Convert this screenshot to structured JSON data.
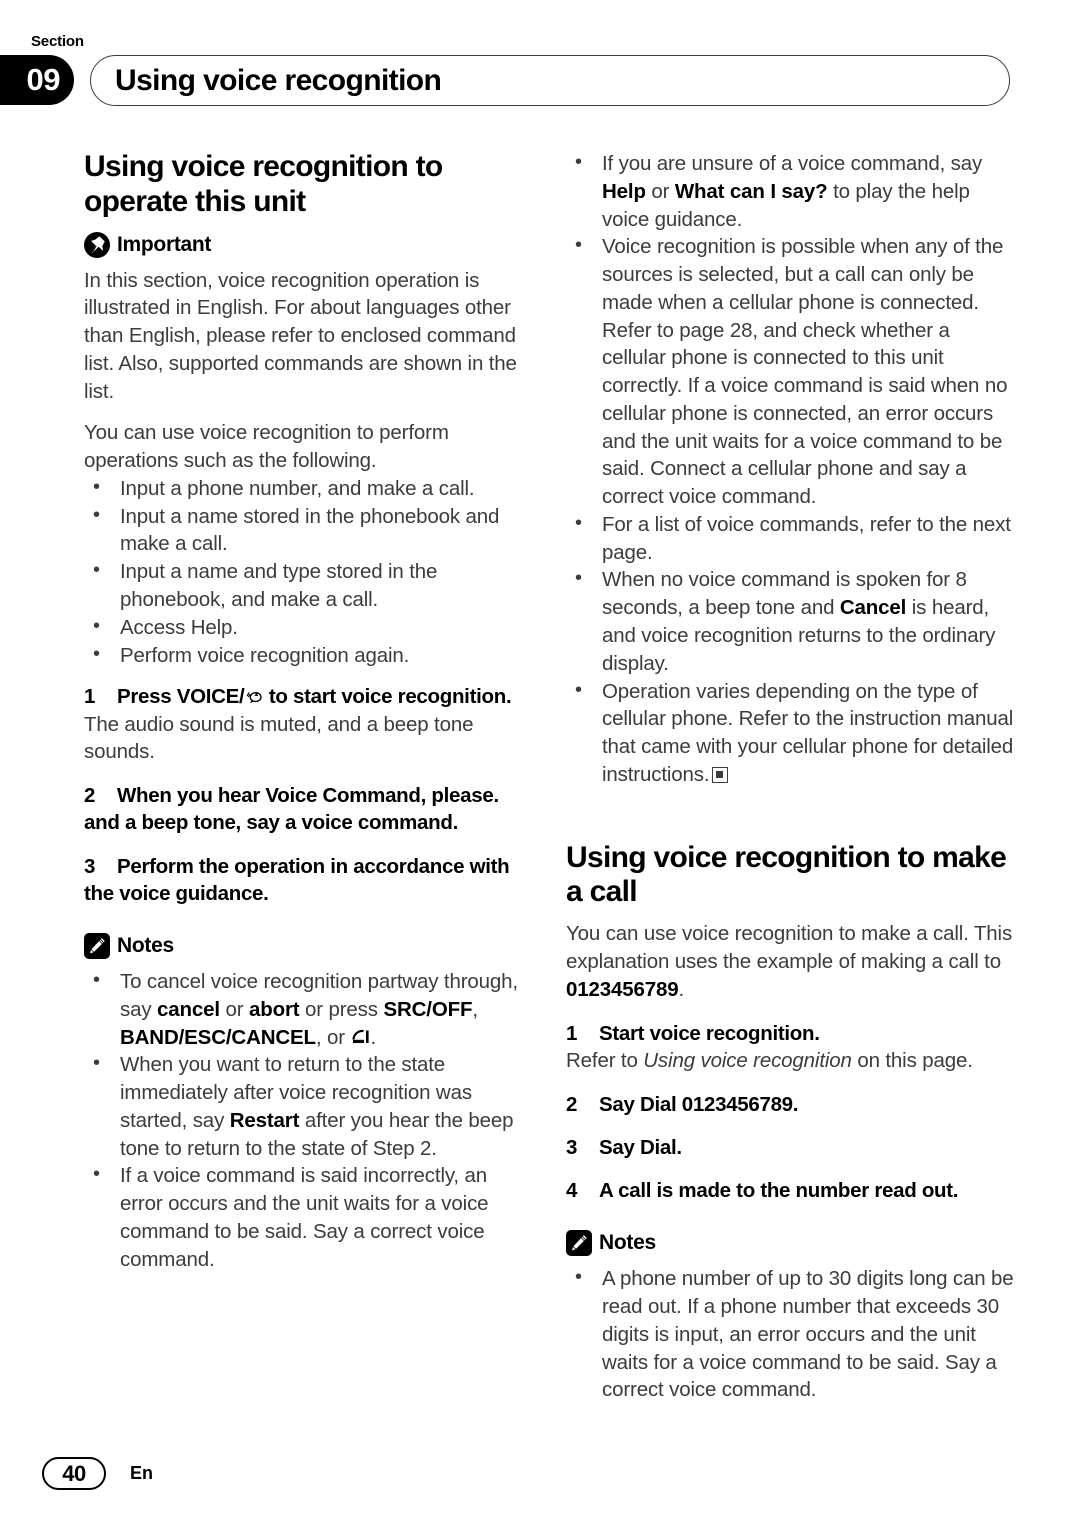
{
  "header": {
    "section_label": "Section",
    "section_number": "09",
    "title": "Using voice recognition"
  },
  "left_column": {
    "heading": "Using voice recognition to operate this unit",
    "important_label": "Important",
    "important_icon": "pushpin-icon",
    "important_body": "In this section, voice recognition operation is illustrated in English. For about languages other than English, please refer to enclosed command list. Also, supported commands are shown in the list.",
    "intro": "You can use voice recognition to perform operations such as the following.",
    "capabilities": [
      "Input a phone number, and make a call.",
      "Input a name stored in the phonebook and make a call.",
      "Input a name and type stored in the phonebook, and make a call.",
      "Access Help.",
      "Perform voice recognition again."
    ],
    "steps": [
      {
        "num": "1",
        "text_before": "Press VOICE/",
        "glyph": "voice-speech-icon",
        "text_after": " to start voice recognition.",
        "sub": "The audio sound is muted, and a beep tone sounds."
      },
      {
        "num": "2",
        "text": "When you hear Voice Command, please. and a beep tone, say a voice command.",
        "sub": ""
      },
      {
        "num": "3",
        "text": "Perform the operation in accordance with the voice guidance.",
        "sub": ""
      }
    ],
    "notes_label": "Notes",
    "notes_icon": "pencil-icon",
    "notes": [
      {
        "parts": [
          {
            "t": "To cancel voice recognition partway through, say ",
            "b": false
          },
          {
            "t": "cancel",
            "b": true
          },
          {
            "t": " or ",
            "b": false
          },
          {
            "t": "abort",
            "b": true
          },
          {
            "t": " or press ",
            "b": false
          },
          {
            "t": "SRC/OFF",
            "b": true
          },
          {
            "t": ", ",
            "b": false
          },
          {
            "t": "BAND/ESC/CANCEL",
            "b": true
          },
          {
            "t": ", or ",
            "b": false
          },
          {
            "t": "HANGUP_GLYPH",
            "b": false
          },
          {
            "t": ".",
            "b": false
          }
        ]
      },
      {
        "parts": [
          {
            "t": "When you want to return to the state immediately after voice recognition was started, say ",
            "b": false
          },
          {
            "t": "Restart",
            "b": true
          },
          {
            "t": " after you hear the beep tone to return to the state of Step 2.",
            "b": false
          }
        ]
      },
      {
        "parts": [
          {
            "t": "If a voice command is said incorrectly, an error occurs and the unit waits for a voice command to be said. Say a correct voice command.",
            "b": false
          }
        ]
      }
    ]
  },
  "right_column": {
    "top_notes": [
      {
        "parts": [
          {
            "t": "If you are unsure of a voice command, say ",
            "b": false
          },
          {
            "t": "Help",
            "b": true
          },
          {
            "t": " or ",
            "b": false
          },
          {
            "t": "What can I say?",
            "b": true
          },
          {
            "t": " to play the help voice guidance.",
            "b": false
          }
        ]
      },
      {
        "parts": [
          {
            "t": "Voice recognition is possible when any of the sources is selected, but a call can only be made when a cellular phone is connected. Refer to page 28, and check whether a cellular phone is connected to this unit correctly. If a voice command is said when no cellular phone is connected, an error occurs and the unit waits for a voice command to be said. Connect a cellular phone and say a correct voice command.",
            "b": false
          }
        ]
      },
      {
        "parts": [
          {
            "t": "For a list of voice commands, refer to the next page.",
            "b": false
          }
        ]
      },
      {
        "parts": [
          {
            "t": "When no voice command is spoken for 8 seconds, a beep tone and ",
            "b": false
          },
          {
            "t": "Cancel",
            "b": true
          },
          {
            "t": " is heard, and voice recognition returns to the ordinary display.",
            "b": false
          }
        ]
      },
      {
        "parts": [
          {
            "t": "Operation varies depending on the type of cellular phone. Refer to the instruction manual that came with your cellular phone for detailed instructions.",
            "b": false
          },
          {
            "t": "EOS_MARKER",
            "b": false
          }
        ]
      }
    ],
    "heading": "Using voice recognition to make a call",
    "intro_parts": [
      {
        "t": "You can use voice recognition to make a call. This explanation uses the example of making a call to ",
        "b": false
      },
      {
        "t": "0123456789",
        "b": true
      },
      {
        "t": ".",
        "b": false
      }
    ],
    "steps": [
      {
        "num": "1",
        "text": "Start voice recognition.",
        "sub_prefix": "Refer to ",
        "sub_italic": "Using voice recognition",
        "sub_suffix": " on this page."
      },
      {
        "num": "2",
        "text": "Say Dial 0123456789.",
        "sub_prefix": "",
        "sub_italic": "",
        "sub_suffix": ""
      },
      {
        "num": "3",
        "text": "Say Dial.",
        "sub_prefix": "",
        "sub_italic": "",
        "sub_suffix": ""
      },
      {
        "num": "4",
        "text": "A call is made to the number read out.",
        "sub_prefix": "",
        "sub_italic": "",
        "sub_suffix": ""
      }
    ],
    "notes_label": "Notes",
    "notes_icon": "pencil-icon",
    "notes": [
      {
        "parts": [
          {
            "t": "A phone number of up to 30 digits long can be read out. If a phone number that exceeds 30 digits is input, an error occurs and the unit waits for a voice command to be said. Say a correct voice command.",
            "b": false
          }
        ]
      }
    ]
  },
  "footer": {
    "page_number": "40",
    "language": "En"
  }
}
